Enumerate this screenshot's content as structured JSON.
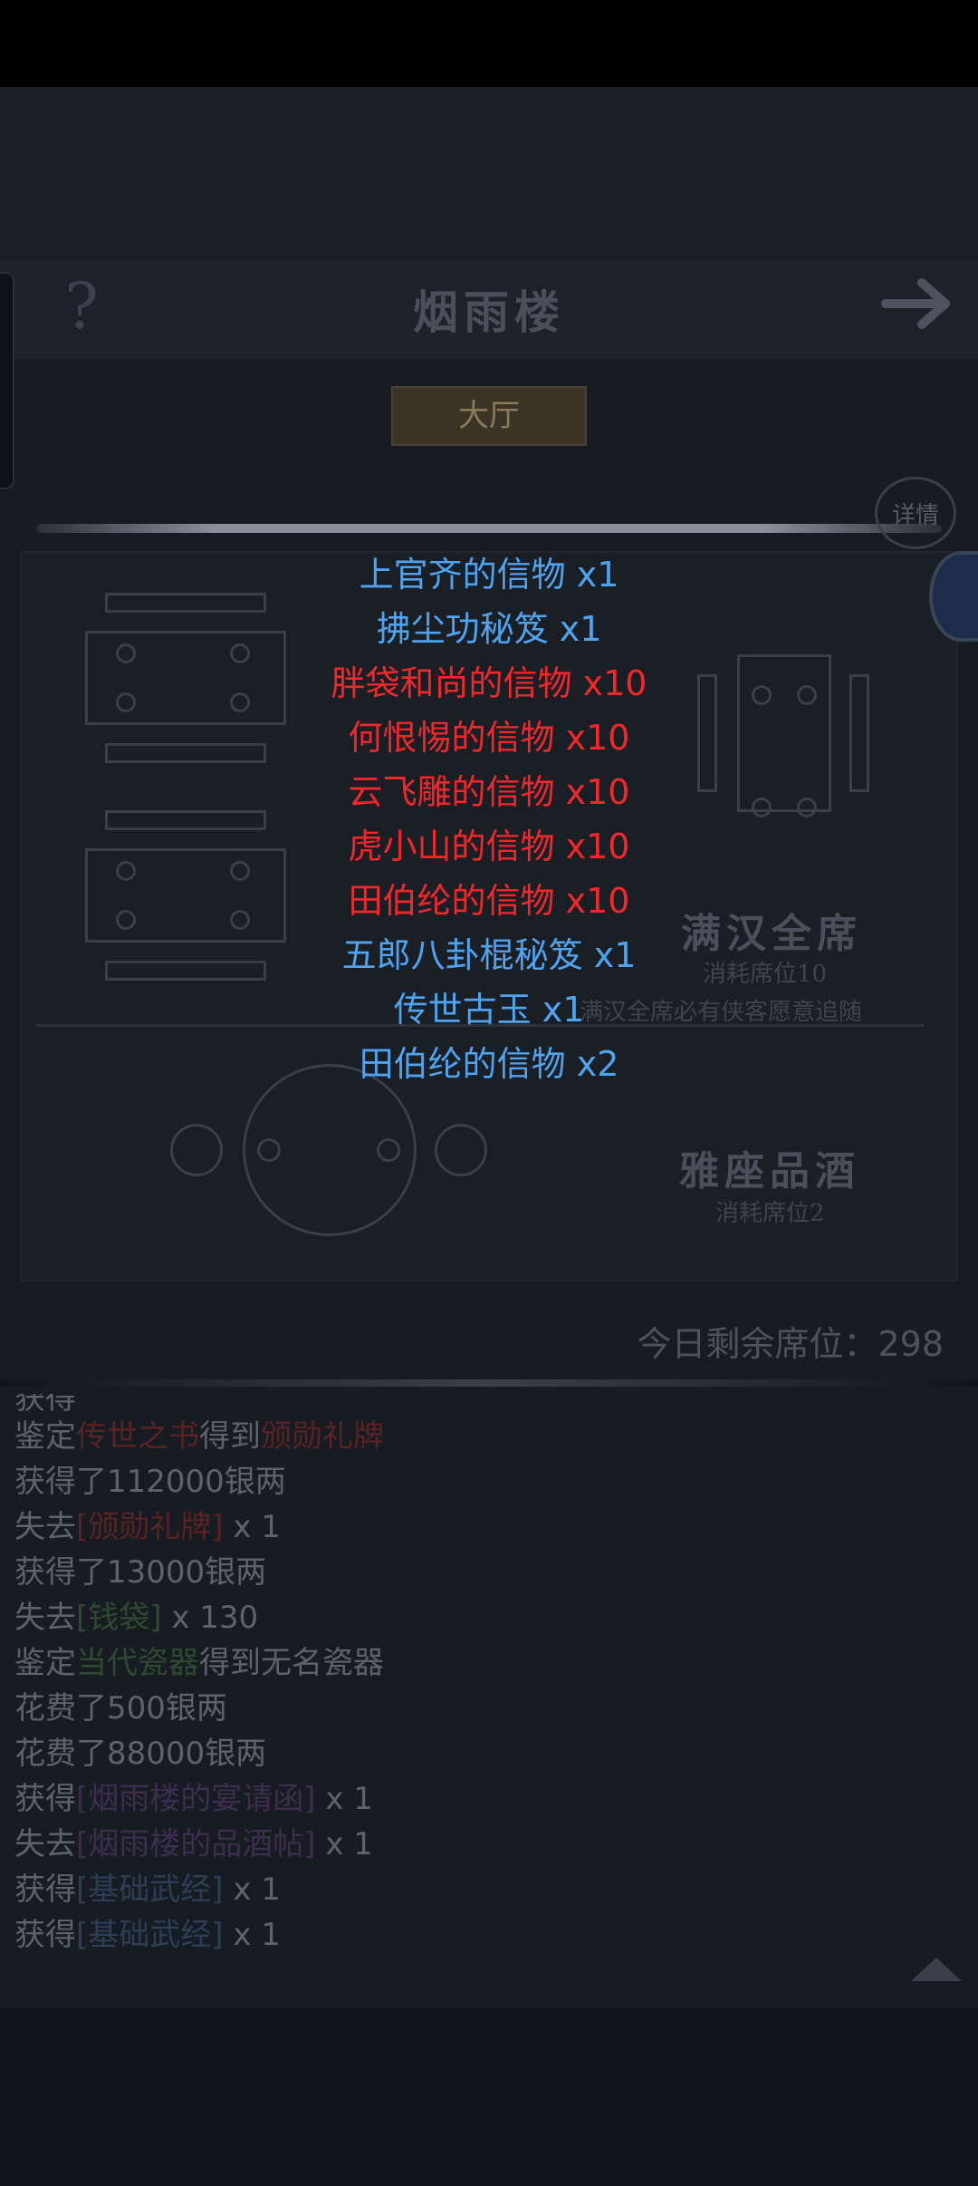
{
  "header": {
    "title": "烟雨楼",
    "help_icon": "?",
    "tab_label": "大厅",
    "detail_label": "详情"
  },
  "tables": [
    {
      "name": "满汉全席",
      "cost": "消耗席位10",
      "desc": "满汉全席必有侠客愿意追随"
    },
    {
      "name": "雅座品酒",
      "cost": "消耗席位2"
    }
  ],
  "seats_text": "今日剩余席位：298",
  "log_cut_line": "获得",
  "log": [
    {
      "prefix": "鉴定",
      "item": "传世之书",
      "item_color": "red",
      "mid": "得到",
      "item2": "颁勋礼牌",
      "item2_color": "red",
      "suffix": ""
    },
    {
      "prefix": "获得了112000银两"
    },
    {
      "prefix": "失去",
      "item": "[颁勋礼牌]",
      "item_color": "red",
      "suffix": " x 1"
    },
    {
      "prefix": "获得了13000银两"
    },
    {
      "prefix": "失去",
      "item": "[钱袋]",
      "item_color": "green",
      "suffix": " x 130"
    },
    {
      "prefix": "鉴定",
      "item": "当代瓷器",
      "item_color": "green",
      "mid": "得到无名瓷器"
    },
    {
      "prefix": "花费了500银两"
    },
    {
      "prefix": "花费了88000银两"
    },
    {
      "prefix": "获得",
      "item": "[烟雨楼的宴请函]",
      "item_color": "purple",
      "suffix": " x 1"
    },
    {
      "prefix": "失去",
      "item": "[烟雨楼的品酒帖]",
      "item_color": "purple",
      "suffix": " x 1"
    },
    {
      "prefix": "获得",
      "item": "[基础武经]",
      "item_color": "blue",
      "suffix": " x 1"
    },
    {
      "prefix": "获得",
      "item": "[基础武经]",
      "item_color": "blue",
      "suffix": " x 1"
    }
  ],
  "rewards": [
    {
      "text": "上官齐的信物 x1",
      "color": "blue"
    },
    {
      "text": "拂尘功秘笈 x1",
      "color": "blue"
    },
    {
      "text": "胖袋和尚的信物 x10",
      "color": "red"
    },
    {
      "text": "何恨惕的信物 x10",
      "color": "red"
    },
    {
      "text": "云飞雕的信物 x10",
      "color": "red"
    },
    {
      "text": "虎小山的信物 x10",
      "color": "red"
    },
    {
      "text": "田伯纶的信物 x10",
      "color": "red"
    },
    {
      "text": "五郎八卦棍秘笈 x1",
      "color": "blue"
    },
    {
      "text": "传世古玉 x1",
      "color": "blue"
    },
    {
      "text": "田伯纶的信物 x2",
      "color": "blue"
    }
  ],
  "colors": {
    "reward_blue": "#4fa3ef",
    "reward_red": "#f0282c"
  }
}
